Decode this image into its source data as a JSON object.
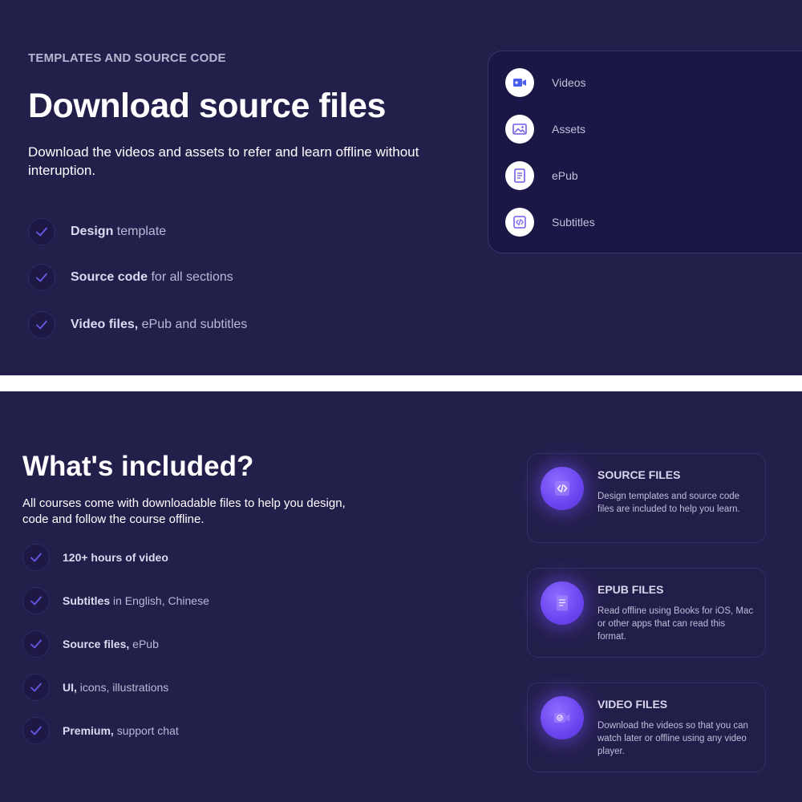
{
  "download": {
    "eyebrow": "TEMPLATES AND SOURCE CODE",
    "title": "Download source files",
    "description": "Download the videos and assets to refer and learn offline without interuption.",
    "features": [
      {
        "strong": "Design",
        "rest": " template"
      },
      {
        "strong": "Source code",
        "rest": " for all sections"
      },
      {
        "strong": "Video files,",
        "rest": " ePub and subtitles"
      }
    ],
    "resources": [
      {
        "label": "Videos",
        "icon": "video-icon"
      },
      {
        "label": "Assets",
        "icon": "image-icon"
      },
      {
        "label": "ePub",
        "icon": "document-icon"
      },
      {
        "label": "Subtitles",
        "icon": "code-icon"
      }
    ]
  },
  "included": {
    "title": "What's included?",
    "description": "All courses come with downloadable files to help you design, code and follow the course offline.",
    "items": [
      {
        "strong": "120+ hours of video",
        "rest": ""
      },
      {
        "strong": "Subtitles",
        "rest": " in English, Chinese"
      },
      {
        "strong": "Source files,",
        "rest": " ePub"
      },
      {
        "strong": "UI,",
        "rest": " icons, illustrations"
      },
      {
        "strong": "Premium,",
        "rest": " support chat"
      }
    ],
    "cards": [
      {
        "title": "SOURCE FILES",
        "description": "Design templates and source code files are included to help you learn.",
        "icon": "code-icon"
      },
      {
        "title": "EPUB FILES",
        "description": "Read offline using Books for iOS, Mac or other apps that can read this format.",
        "icon": "document-icon"
      },
      {
        "title": "VIDEO FILES",
        "description": "Download the videos so that you can watch later or offline using any video player.",
        "icon": "video-icon"
      }
    ]
  },
  "colors": {
    "background": "#231f4b",
    "card": "#1a1645",
    "accent": "#6a45f0",
    "check": "#6b58e8"
  }
}
